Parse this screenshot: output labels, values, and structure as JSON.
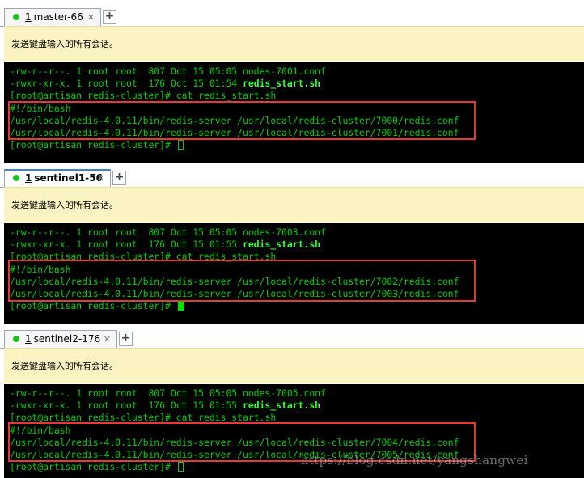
{
  "notice_text": "发送键盘输入的所有会话。",
  "panes": [
    {
      "tab": {
        "num": "1",
        "label": "master-66",
        "close": "✕"
      },
      "add": "+",
      "lines": [
        {
          "t": "-rw-r--r--. 1 root root  807 Oct 15 05:05 nodes-7001.conf"
        },
        {
          "t": "-rwxr-xr-x. 1 root root  176 Oct 15 01:54 ",
          "b": "redis_start.sh"
        },
        {
          "t": "[root@artisan redis-cluster]# cat redis_start.sh"
        },
        {
          "t": "#!/bin/bash"
        },
        {
          "t": "/usr/local/redis-4.0.11/bin/redis-server /usr/local/redis-cluster/7000/redis.conf"
        },
        {
          "t": "/usr/local/redis-4.0.11/bin/redis-server /usr/local/redis-cluster/7001/redis.conf"
        },
        {
          "t": "[root@artisan redis-cluster]# "
        }
      ]
    },
    {
      "tab": {
        "num": "1",
        "label": "sentinel1-56",
        "close": "✕"
      },
      "add": "+",
      "lines": [
        {
          "t": "-rw-r--r--. 1 root root  807 Oct 15 05:05 nodes-7003.conf"
        },
        {
          "t": "-rwxr-xr-x. 1 root root  176 Oct 15 01:55 ",
          "b": "redis_start.sh"
        },
        {
          "t": "[root@artisan redis-cluster]# cat redis_start.sh"
        },
        {
          "t": "#!/bin/bash"
        },
        {
          "t": "/usr/local/redis-4.0.11/bin/redis-server /usr/local/redis-cluster/7002/redis.conf"
        },
        {
          "t": "/usr/local/redis-4.0.11/bin/redis-server /usr/local/redis-cluster/7003/redis.conf"
        },
        {
          "t": "[root@artisan redis-cluster]# "
        }
      ]
    },
    {
      "tab": {
        "num": "1",
        "label": "sentinel2-176",
        "close": "✕"
      },
      "add": "+",
      "lines": [
        {
          "t": "-rw-r--r--. 1 root root  807 Oct 15 05:05 nodes-7005.conf"
        },
        {
          "t": "-rwxr-xr-x. 1 root root  176 Oct 15 01:55 ",
          "b": "redis_start.sh"
        },
        {
          "t": "[root@artisan redis-cluster]# cat redis_start.sh"
        },
        {
          "t": "#!/bin/bash"
        },
        {
          "t": "/usr/local/redis-4.0.11/bin/redis-server /usr/local/redis-cluster/7004/redis.conf"
        },
        {
          "t": "/usr/local/redis-4.0.11/bin/redis-server /usr/local/redis-cluster/7005/redis.conf"
        },
        {
          "t": "[root@artisan redis-cluster]# "
        }
      ]
    }
  ],
  "watermark": "https://blog.csdn.net/yangshangwei",
  "colors": {
    "terminal_bg": "#000000",
    "terminal_fg": "#00d200",
    "highlight": "#e53935",
    "notice_bg": "#fbf3c2",
    "tab_active": "#3a86d6"
  }
}
